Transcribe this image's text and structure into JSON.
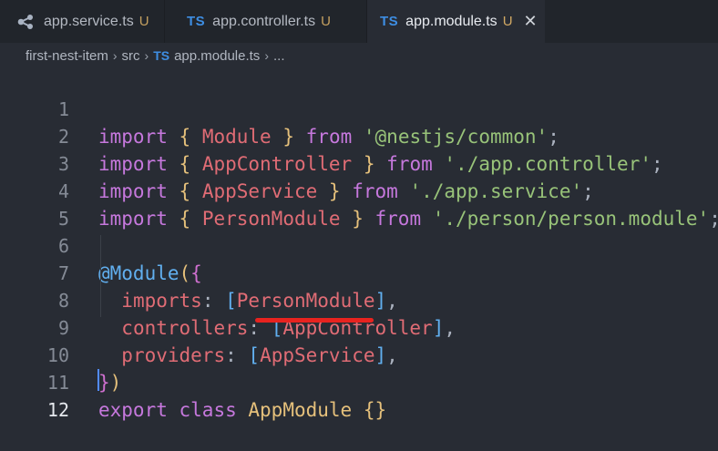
{
  "tabs": [
    {
      "name": "app.service.ts",
      "status": "U",
      "icon": "nest-service-icon"
    },
    {
      "badge": "TS",
      "name": "app.controller.ts",
      "status": "U"
    },
    {
      "badge": "TS",
      "name": "app.module.ts",
      "status": "U",
      "active": true,
      "close": "✕"
    }
  ],
  "breadcrumb": {
    "folder": "first-nest-item",
    "sub": "src",
    "badge": "TS",
    "file": "app.module.ts",
    "more": "..."
  },
  "lines": [
    {
      "n": "1",
      "t": [
        "import",
        " ",
        "{",
        " ",
        "Module",
        " ",
        "}",
        " ",
        "from",
        " ",
        "'@nestjs/common'",
        ";"
      ]
    },
    {
      "n": "2",
      "t": [
        "import",
        " ",
        "{",
        " ",
        "AppController",
        " ",
        "}",
        " ",
        "from",
        " ",
        "'./app.controller'",
        ";"
      ]
    },
    {
      "n": "3",
      "t": [
        "import",
        " ",
        "{",
        " ",
        "AppService",
        " ",
        "}",
        " ",
        "from",
        " ",
        "'./app.service'",
        ";"
      ]
    },
    {
      "n": "4",
      "t": [
        "import",
        " ",
        "{",
        " ",
        "PersonModule",
        " ",
        "}",
        " ",
        "from",
        " ",
        "'./person/person.module'",
        ";"
      ]
    },
    {
      "n": "5",
      "t": []
    },
    {
      "n": "6",
      "t": [
        "@Module",
        "(",
        "{"
      ]
    },
    {
      "n": "7",
      "t": [
        "  ",
        "imports",
        ":",
        " ",
        "[",
        "PersonModule",
        "]",
        ","
      ]
    },
    {
      "n": "8",
      "t": [
        "  ",
        "controllers",
        ":",
        " ",
        "[",
        "AppController",
        "]",
        ","
      ]
    },
    {
      "n": "9",
      "t": [
        "  ",
        "providers",
        ":",
        " ",
        "[",
        "AppService",
        "]",
        ","
      ]
    },
    {
      "n": "10",
      "t": [
        "}",
        ")"
      ]
    },
    {
      "n": "11",
      "t": [
        "export",
        " ",
        "class",
        " ",
        "AppModule",
        " ",
        "{}"
      ]
    },
    {
      "n": "12",
      "t": []
    }
  ],
  "colors": {
    "keyword": "#c678dd",
    "string": "#98c379",
    "identifier": "#e06c75",
    "class": "#e5c07b",
    "decorator": "#61afef",
    "highlight_underline": "#e8231f"
  }
}
